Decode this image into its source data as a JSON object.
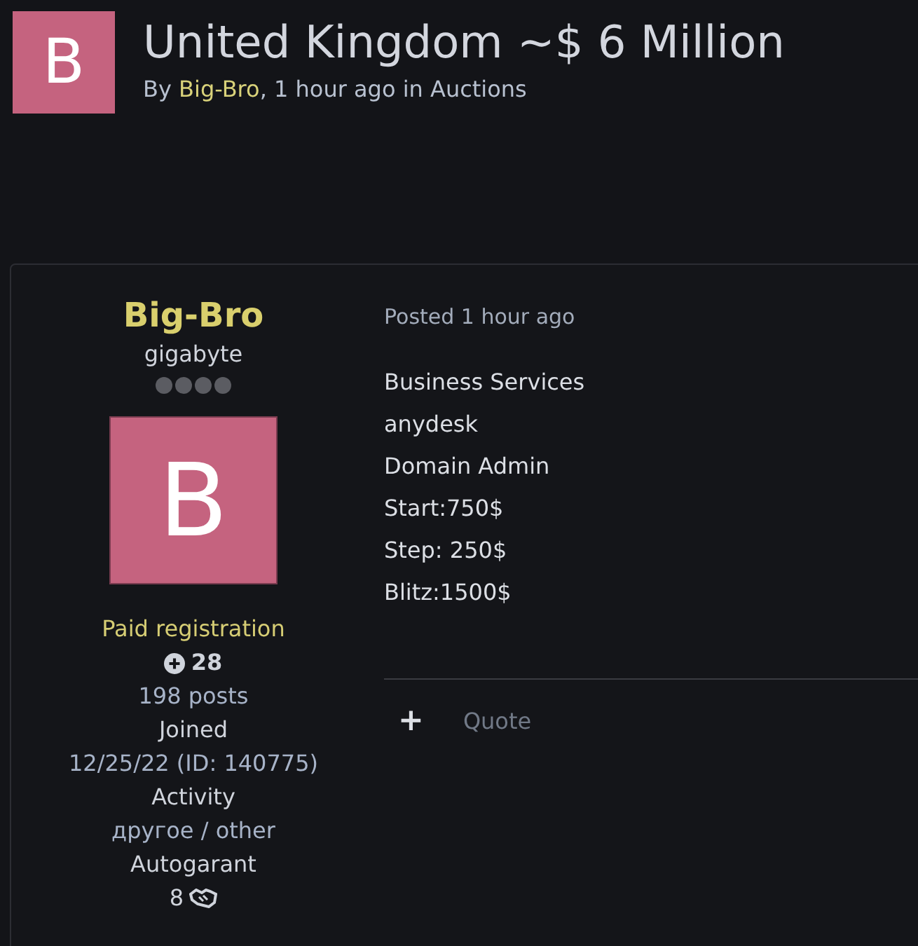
{
  "topic": {
    "avatar_letter": "B",
    "title": "United Kingdom ~$ 6 Million",
    "byline_prefix": "By",
    "author": "Big-Bro",
    "byline_middle": ", 1 hour ago in",
    "forum": "Auctions"
  },
  "author_panel": {
    "name": "Big-Bro",
    "rank": "gigabyte",
    "avatar_letter": "B",
    "group": "Paid registration",
    "reputation": "28",
    "posts": "198 posts",
    "joined_label": "Joined",
    "joined_value": "12/25/22 (ID: 140775)",
    "activity_label": "Activity",
    "activity_value": "другое / other",
    "autogarant_label": "Autogarant",
    "autogarant_value": "8"
  },
  "post": {
    "meta": "Posted 1 hour ago",
    "lines": [
      "Business Services",
      "anydesk",
      "Domain Admin",
      "Start:750$",
      "Step: 250$",
      "Blitz:1500$"
    ],
    "actions": {
      "plus": "+",
      "quote": "Quote"
    }
  }
}
